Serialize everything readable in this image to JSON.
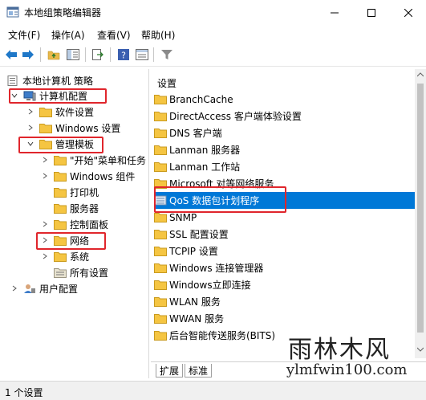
{
  "window": {
    "title": "本地组策略编辑器"
  },
  "menu": [
    "文件(F)",
    "操作(A)",
    "查看(V)",
    "帮助(H)"
  ],
  "tree": {
    "root": "本地计算机 策略",
    "computer_config": "计算机配置",
    "software_settings": "软件设置",
    "windows_settings": "Windows 设置",
    "admin_templates": "管理模板",
    "start_menu": "\"开始\"菜单和任务",
    "windows_components": "Windows 组件",
    "printers": "打印机",
    "servers": "服务器",
    "control_panel": "控制面板",
    "network": "网络",
    "system": "系统",
    "all_settings": "所有设置",
    "user_config": "用户配置"
  },
  "list": {
    "header": "设置",
    "items": [
      "BranchCache",
      "DirectAccess 客户端体验设置",
      "DNS 客户端",
      "Lanman 服务器",
      "Lanman 工作站",
      "Microsoft 对等网络服务",
      "QoS 数据包计划程序",
      "SNMP",
      "SSL 配置设置",
      "TCPIP 设置",
      "Windows 连接管理器",
      "Windows立即连接",
      "WLAN 服务",
      "WWAN 服务",
      "后台智能传送服务(BITS)"
    ],
    "selected_index": 6
  },
  "tabs": [
    "扩展",
    "标准"
  ],
  "status": "1 个设置",
  "watermark": {
    "title": "雨林木风",
    "url": "ylmfwin100.com"
  },
  "colors": {
    "selection": "#0078d7",
    "highlight_box": "#e0262c",
    "folder": "#f5c542"
  }
}
